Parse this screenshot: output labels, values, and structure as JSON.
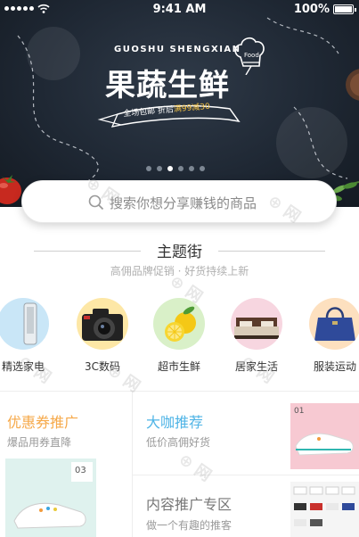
{
  "status_bar": {
    "time": "9:41 AM",
    "battery": "100%"
  },
  "hero": {
    "pinyin": "GUOSHU SHENGXIAN",
    "title": "果蔬生鲜",
    "ribbon_left": "全场包邮",
    "ribbon_mid": " 折后",
    "ribbon_highlight": "满99减30",
    "hat_text": "Food",
    "dots_count": 6,
    "active_dot": 2
  },
  "search": {
    "placeholder": "搜索你想分享赚钱的商品"
  },
  "section": {
    "title": "主题街",
    "subtitle": "高佣品牌促销 · 好货持续上新"
  },
  "categories": [
    {
      "label": "精选家电",
      "icon": "appliance-icon",
      "color": "#c9e6f7"
    },
    {
      "label": "3C数码",
      "icon": "camera-icon",
      "color": "#fde7a6"
    },
    {
      "label": "超市生鲜",
      "icon": "lemon-icon",
      "color": "#d9f0c8"
    },
    {
      "label": "居家生活",
      "icon": "bed-icon",
      "color": "#f7d6e0"
    },
    {
      "label": "服装运动",
      "icon": "handbag-icon",
      "color": "#fde0bf"
    }
  ],
  "promos": {
    "coupon": {
      "title": "优惠券推广",
      "subtitle": "爆品用券直降",
      "title_color": "#f6a94a"
    },
    "cafe": {
      "title": "大咖推荐",
      "subtitle": "低价高佣好货",
      "title_color": "#4fb4e6",
      "badge": "01"
    },
    "content": {
      "title": "内容推广专区",
      "subtitle": "做一个有趣的推客",
      "title_color": "#777777"
    }
  },
  "coupon_badge": "03"
}
